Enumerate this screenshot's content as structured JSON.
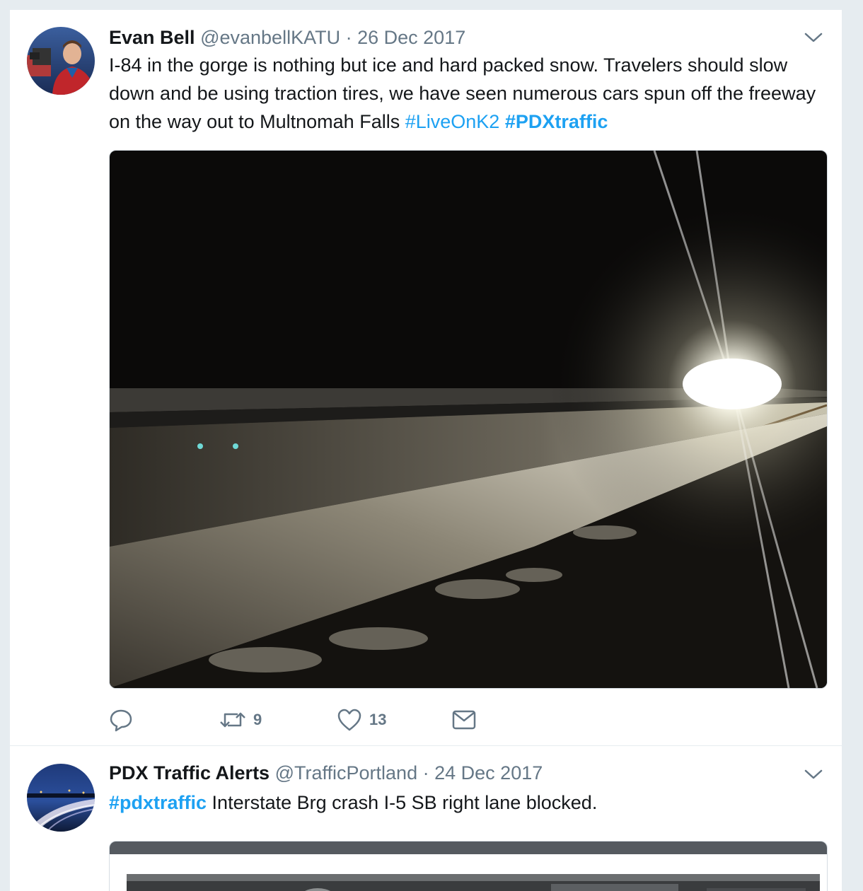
{
  "tweets": [
    {
      "name": "Evan Bell",
      "handle": "@evanbellKATU",
      "separator": "·",
      "date": "26 Dec 2017",
      "text": "I-84 in the gorge is nothing but ice and hard packed snow. Travelers should slow down and be using traction tires, we have seen numerous cars spun off the freeway on the way out to Multnomah Falls ",
      "hashtags": [
        "#LiveOnK2",
        "#PDXtraffic"
      ],
      "retweet_count": "9",
      "like_count": "13"
    },
    {
      "name": "PDX Traffic Alerts",
      "handle": "@TrafficPortland",
      "separator": "·",
      "date": "24 Dec 2017",
      "hashtag": "#pdxtraffic",
      "text": " Interstate Brg crash I-5 SB right lane blocked."
    }
  ],
  "icons": {
    "reply": "reply-icon",
    "retweet": "retweet-icon",
    "like": "heart-icon",
    "dm": "envelope-icon",
    "more": "chevron-down-icon"
  },
  "colors": {
    "link": "#1da1f2",
    "secondary": "#657786",
    "text": "#14171a",
    "background": "#e6ecf0"
  }
}
